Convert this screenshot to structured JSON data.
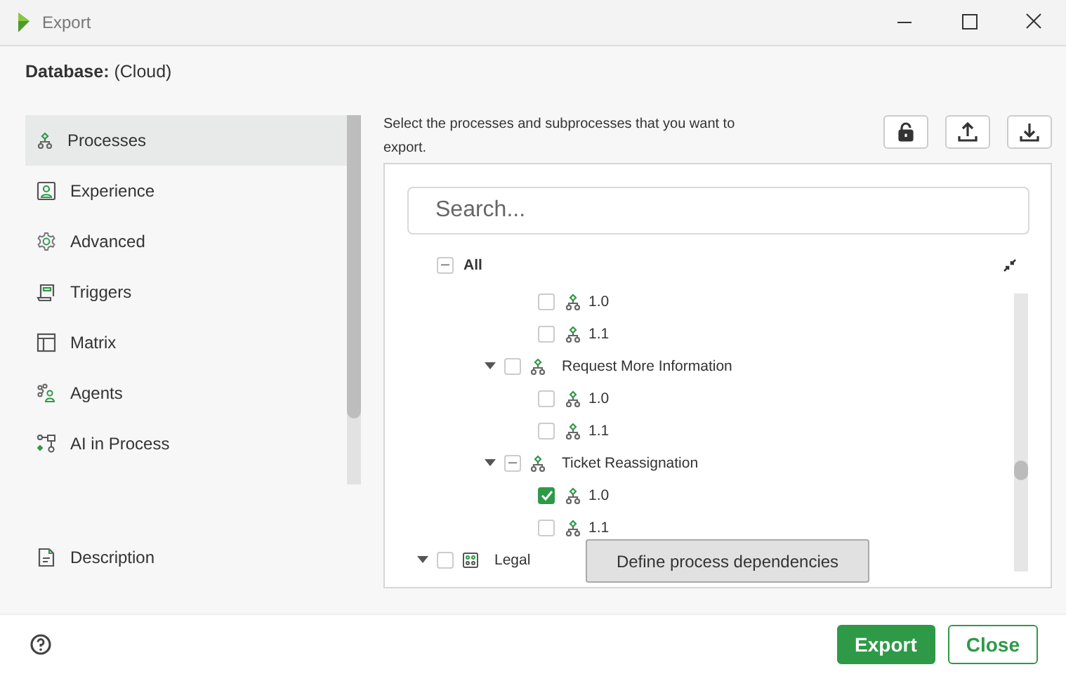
{
  "window": {
    "title": "Export"
  },
  "database": {
    "label": "Database:",
    "value": "(Cloud)"
  },
  "nav": {
    "items": [
      {
        "label": "Processes",
        "kind": "process",
        "selected": true
      },
      {
        "label": "Experience",
        "kind": "person",
        "selected": false
      },
      {
        "label": "Advanced",
        "kind": "gear",
        "selected": false
      },
      {
        "label": "Triggers",
        "kind": "scroll",
        "selected": false
      },
      {
        "label": "Matrix",
        "kind": "table",
        "selected": false
      },
      {
        "label": "Agents",
        "kind": "agents",
        "selected": false
      },
      {
        "label": "AI in Process",
        "kind": "ai",
        "selected": false
      }
    ],
    "footer_items": [
      {
        "label": "Description",
        "kind": "document",
        "selected": false
      }
    ]
  },
  "instructions": "Select the processes and subprocesses that you want to export.",
  "toolbar": [
    {
      "kind": "lock"
    },
    {
      "kind": "upload"
    },
    {
      "kind": "download"
    }
  ],
  "search": {
    "placeholder": "Search..."
  },
  "tree": [
    {
      "label": "All",
      "kind": "root",
      "checked": false,
      "partial": true,
      "children": [
        {
          "kind": "hidden",
          "children": [
            {
              "kind": "hidden",
              "children": [
                {
                  "label": "1.0",
                  "kind": "version",
                  "checked": false,
                  "partial": false
                },
                {
                  "label": "1.1",
                  "kind": "version",
                  "checked": false,
                  "partial": false
                }
              ]
            },
            {
              "label": "Request More Information",
              "kind": "process",
              "expanded": true,
              "checked": false,
              "partial": false,
              "children": [
                {
                  "label": "1.0",
                  "kind": "version",
                  "checked": false,
                  "partial": false
                },
                {
                  "label": "1.1",
                  "kind": "version",
                  "checked": false,
                  "partial": false
                }
              ]
            },
            {
              "label": "Ticket Reassignation",
              "kind": "process",
              "expanded": true,
              "checked": false,
              "partial": true,
              "children": [
                {
                  "label": "1.0",
                  "kind": "version",
                  "checked": true,
                  "partial": false
                },
                {
                  "label": "1.1",
                  "kind": "version",
                  "checked": false,
                  "partial": false
                }
              ]
            }
          ]
        }
      ]
    },
    {
      "label": "Legal",
      "kind": "category",
      "expanded": true,
      "checked": false,
      "partial": false
    }
  ],
  "tooltip": "Define process dependencies",
  "footer": {
    "buttons": [
      {
        "label": "Export",
        "kind": "primary"
      },
      {
        "label": "Close",
        "kind": "secondary"
      }
    ]
  }
}
